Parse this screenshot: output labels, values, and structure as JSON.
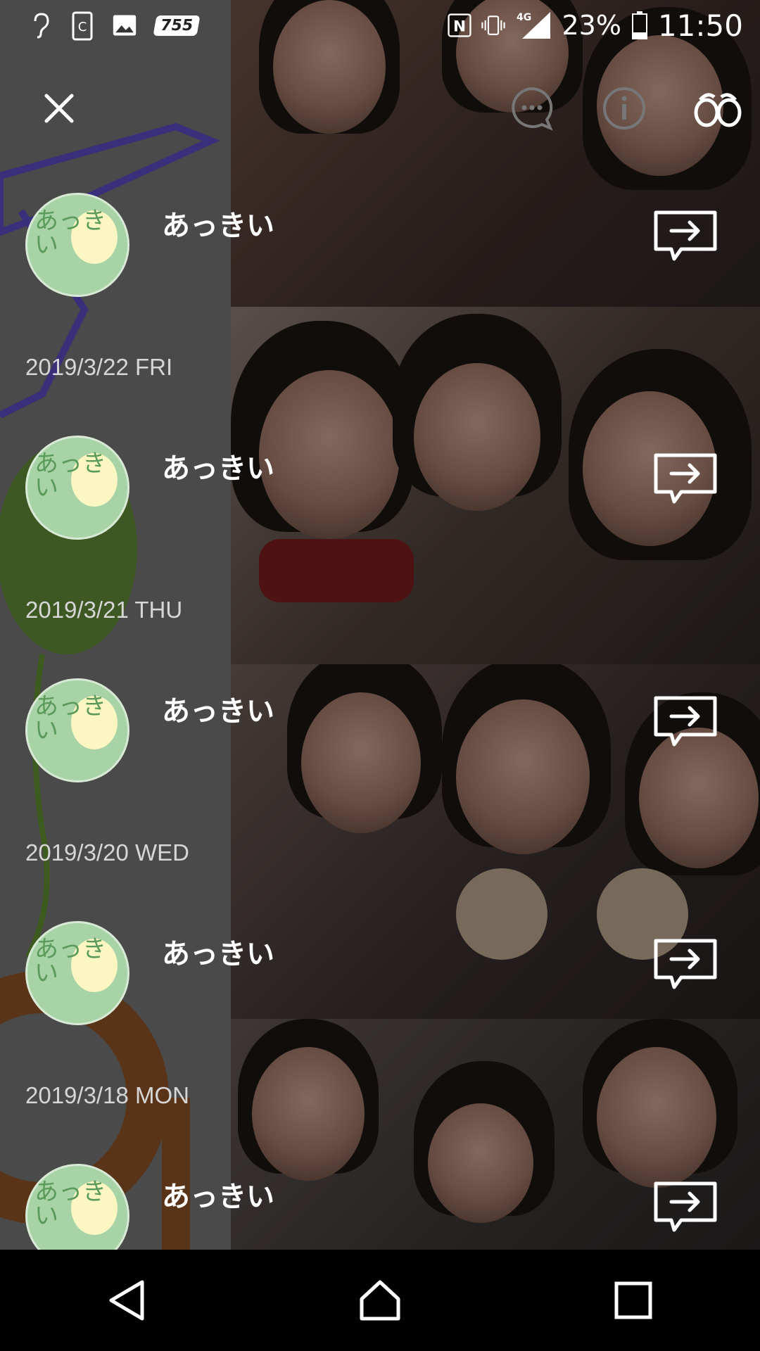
{
  "status_bar": {
    "battery": "23%",
    "time": "11:50",
    "network": "4G",
    "icons": [
      "hearing-icon",
      "clipboard-icon",
      "image-icon",
      "755-app-icon",
      "nfc-icon",
      "vibrate-icon",
      "signal-icon",
      "battery-icon"
    ],
    "app_badge": "755"
  },
  "toolbar": {
    "icons": [
      "close-icon",
      "chat-icon",
      "info-icon",
      "binoculars-icon"
    ]
  },
  "posts": [
    {
      "name": "あっきい",
      "avatar_text": "あっきい"
    },
    {
      "name": "あっきい",
      "avatar_text": "あっきい"
    },
    {
      "name": "あっきい",
      "avatar_text": "あっきい"
    },
    {
      "name": "あっきい",
      "avatar_text": "あっきい"
    },
    {
      "name": "あっきい",
      "avatar_text": "あっきい"
    }
  ],
  "dates": [
    "2019/3/22 FRI",
    "2019/3/21 THU",
    "2019/3/20 WED",
    "2019/3/18 MON"
  ],
  "nav_bar": {
    "icons": [
      "back-icon",
      "home-icon",
      "recents-icon"
    ]
  },
  "colors": {
    "panel": "#4a4a4a",
    "avatar_bg": "#a7d3a6",
    "balloon": "#fbf6c2",
    "date_text": "#d6d6d6"
  }
}
